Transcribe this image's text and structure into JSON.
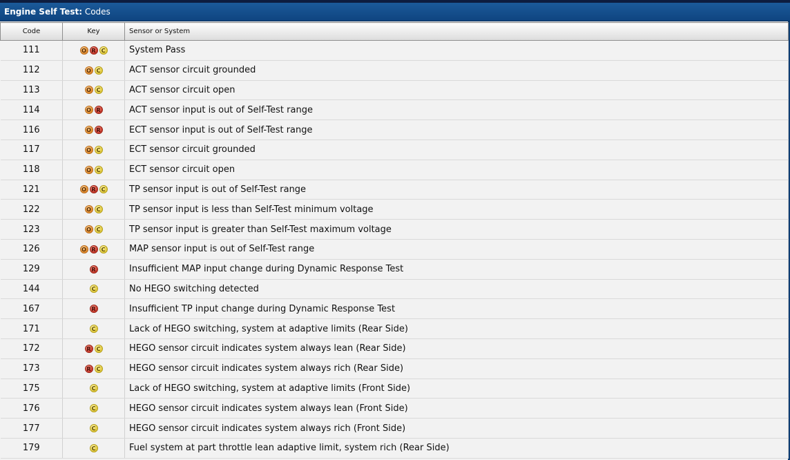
{
  "window": {
    "title_bold": "Engine Self Test:",
    "title_rest": " Codes"
  },
  "table": {
    "columns": [
      "Code",
      "Key",
      "Sensor or System"
    ],
    "key_labels": {
      "O": "O",
      "R": "R",
      "C": "C"
    },
    "colors": {
      "O": "#e08a2b",
      "R": "#c8392b",
      "C": "#e1c93a"
    },
    "rows": [
      {
        "code": "111",
        "key": [
          "O",
          "R",
          "C"
        ],
        "desc": "System Pass"
      },
      {
        "code": "112",
        "key": [
          "O",
          "C"
        ],
        "desc": "ACT sensor circuit grounded"
      },
      {
        "code": "113",
        "key": [
          "O",
          "C"
        ],
        "desc": "ACT sensor circuit open"
      },
      {
        "code": "114",
        "key": [
          "O",
          "R"
        ],
        "desc": "ACT sensor input is out of Self-Test range"
      },
      {
        "code": "116",
        "key": [
          "O",
          "R"
        ],
        "desc": "ECT sensor input is out of Self-Test range"
      },
      {
        "code": "117",
        "key": [
          "O",
          "C"
        ],
        "desc": "ECT sensor circuit grounded"
      },
      {
        "code": "118",
        "key": [
          "O",
          "C"
        ],
        "desc": "ECT sensor circuit open"
      },
      {
        "code": "121",
        "key": [
          "O",
          "R",
          "C"
        ],
        "desc": "TP sensor input is out of Self-Test range"
      },
      {
        "code": "122",
        "key": [
          "O",
          "C"
        ],
        "desc": "TP sensor input is less than Self-Test minimum voltage"
      },
      {
        "code": "123",
        "key": [
          "O",
          "C"
        ],
        "desc": "TP sensor input is greater than Self-Test maximum voltage"
      },
      {
        "code": "126",
        "key": [
          "O",
          "R",
          "C"
        ],
        "desc": "MAP sensor input is out of Self-Test range"
      },
      {
        "code": "129",
        "key": [
          "R"
        ],
        "desc": "Insufficient MAP input change during Dynamic Response Test"
      },
      {
        "code": "144",
        "key": [
          "C"
        ],
        "desc": "No HEGO switching detected"
      },
      {
        "code": "167",
        "key": [
          "R"
        ],
        "desc": "Insufficient TP input change during Dynamic Response Test"
      },
      {
        "code": "171",
        "key": [
          "C"
        ],
        "desc": "Lack of HEGO switching, system at adaptive limits (Rear Side)"
      },
      {
        "code": "172",
        "key": [
          "R",
          "C"
        ],
        "desc": "HEGO sensor circuit indicates system always lean (Rear Side)"
      },
      {
        "code": "173",
        "key": [
          "R",
          "C"
        ],
        "desc": "HEGO sensor circuit indicates system always rich (Rear Side)"
      },
      {
        "code": "175",
        "key": [
          "C"
        ],
        "desc": "Lack of HEGO switching, system at adaptive limits (Front Side)"
      },
      {
        "code": "176",
        "key": [
          "C"
        ],
        "desc": "HEGO sensor circuit indicates system always lean (Front Side)"
      },
      {
        "code": "177",
        "key": [
          "C"
        ],
        "desc": "HEGO sensor circuit indicates system always rich (Front Side)"
      },
      {
        "code": "179",
        "key": [
          "C"
        ],
        "desc": "Fuel system at part throttle lean adaptive limit, system rich (Rear Side)"
      }
    ]
  }
}
